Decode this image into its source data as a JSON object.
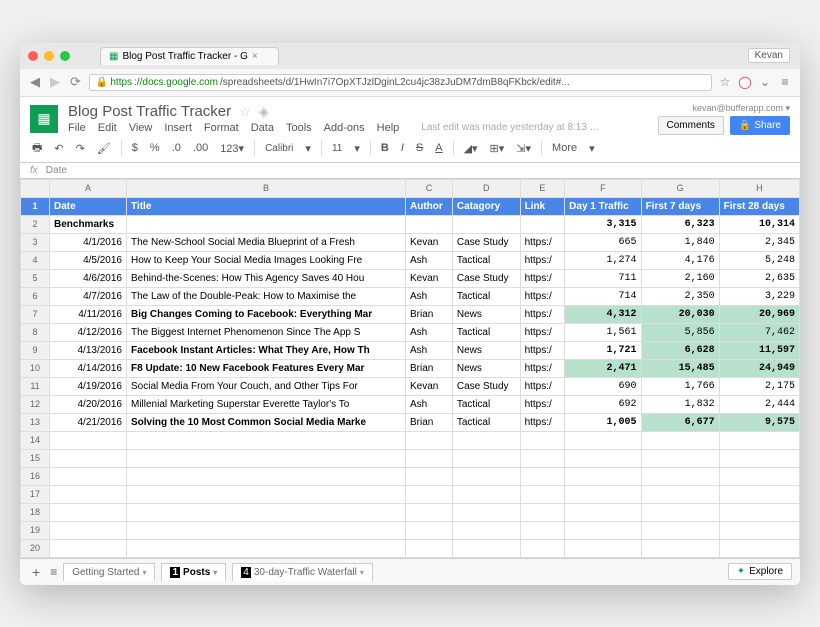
{
  "titlebar": {
    "tab_title": "Blog Post Traffic Tracker - G",
    "user": "Kevan"
  },
  "url": {
    "protocol": "https",
    "host": "://docs.google.com",
    "path": "/spreadsheets/d/1HwIn7i7OpXTJzlDginL2cu4jc38zJuDM7dmB8qFKbck/edit#..."
  },
  "doc": {
    "title": "Blog Post Traffic Tracker",
    "email": "kevan@bufferapp.com ▾"
  },
  "menus": [
    "File",
    "Edit",
    "View",
    "Insert",
    "Format",
    "Data",
    "Tools",
    "Add-ons",
    "Help"
  ],
  "status": "Last edit was made yesterday at 8:13 …",
  "btns": {
    "comments": "Comments",
    "share": "Share"
  },
  "toolbar": {
    "font": "Calibri",
    "size": "11",
    "more": "More"
  },
  "fx": "Date",
  "cols": [
    "",
    "A",
    "B",
    "C",
    "D",
    "E",
    "F",
    "G",
    "H"
  ],
  "headers": [
    "Date",
    "Title",
    "Author",
    "Catagory",
    "Link",
    "Day 1 Traffic",
    "First 7 days",
    "First 28 days"
  ],
  "benchmarks": {
    "label": "Benchmarks",
    "d1": "3,315",
    "d7": "6,323",
    "d28": "10,314"
  },
  "rows": [
    {
      "n": 3,
      "date": "4/1/2016",
      "title": "The New-School Social Media Blueprint of a Fresh",
      "author": "Kevan",
      "cat": "Case Study",
      "link": "https:/",
      "d1": "665",
      "d7": "1,840",
      "d28": "2,345"
    },
    {
      "n": 4,
      "date": "4/5/2016",
      "title": "How to Keep Your Social Media Images Looking Fre",
      "author": "Ash",
      "cat": "Tactical",
      "link": "https:/",
      "d1": "1,274",
      "d7": "4,176",
      "d28": "5,248"
    },
    {
      "n": 5,
      "date": "4/6/2016",
      "title": "Behind-the-Scenes: How This Agency Saves 40 Hou",
      "author": "Kevan",
      "cat": "Case Study",
      "link": "https:/",
      "d1": "711",
      "d7": "2,160",
      "d28": "2,635"
    },
    {
      "n": 6,
      "date": "4/7/2016",
      "title": "The Law of the Double-Peak: How to Maximise the",
      "author": "Ash",
      "cat": "Tactical",
      "link": "https:/",
      "d1": "714",
      "d7": "2,350",
      "d28": "3,229"
    },
    {
      "n": 7,
      "date": "4/11/2016",
      "title": "Big Changes Coming to Facebook: Everything Mar",
      "author": "Brian",
      "cat": "News",
      "link": "https:/",
      "d1": "4,312",
      "d7": "20,030",
      "d28": "20,969",
      "bold": true,
      "hl": true
    },
    {
      "n": 8,
      "date": "4/12/2016",
      "title": "The Biggest Internet Phenomenon Since The App S",
      "author": "Ash",
      "cat": "Tactical",
      "link": "https:/",
      "d1": "1,561",
      "d7": "5,856",
      "d28": "7,462",
      "hl7": true,
      "hl28": true
    },
    {
      "n": 9,
      "date": "4/13/2016",
      "title": "Facebook Instant Articles: What They Are, How Th",
      "author": "Ash",
      "cat": "News",
      "link": "https:/",
      "d1": "1,721",
      "d7": "6,628",
      "d28": "11,597",
      "bold": true,
      "hl7": true,
      "hl28": true
    },
    {
      "n": 10,
      "date": "4/14/2016",
      "title": "F8 Update: 10 New Facebook Features Every Mar",
      "author": "Brian",
      "cat": "News",
      "link": "https:/",
      "d1": "2,471",
      "d7": "15,485",
      "d28": "24,949",
      "bold": true,
      "hl": true
    },
    {
      "n": 11,
      "date": "4/19/2016",
      "title": "Social Media From Your Couch, and Other Tips For",
      "author": "Kevan",
      "cat": "Case Study",
      "link": "https:/",
      "d1": "690",
      "d7": "1,766",
      "d28": "2,175"
    },
    {
      "n": 12,
      "date": "4/20/2016",
      "title": "Millenial Marketing Superstar Everette Taylor's To",
      "author": "Ash",
      "cat": "Tactical",
      "link": "https:/",
      "d1": "692",
      "d7": "1,832",
      "d28": "2,444"
    },
    {
      "n": 13,
      "date": "4/21/2016",
      "title": "Solving the 10 Most Common Social Media Marke",
      "author": "Brian",
      "cat": "Tactical",
      "link": "https:/",
      "d1": "1,005",
      "d7": "6,677",
      "d28": "9,575",
      "bold": true,
      "hl7": true,
      "hl28": true
    }
  ],
  "sheets": {
    "add": "+",
    "s1": "Getting Started",
    "s2": "Posts",
    "s3": "30-day-Traffic Waterfall",
    "explore": "Explore"
  }
}
